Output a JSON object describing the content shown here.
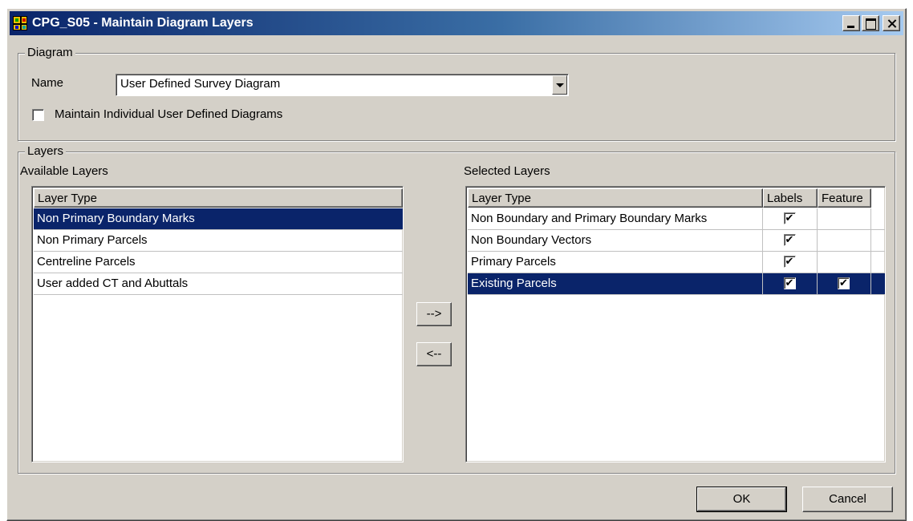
{
  "window": {
    "title": "CPG_S05 - Maintain Diagram Layers"
  },
  "diagram": {
    "legend": "Diagram",
    "name_label": "Name",
    "name_value": "User Defined Survey Diagram",
    "individual_label": "Maintain Individual User Defined Diagrams",
    "individual_checked": false
  },
  "layers": {
    "legend": "Layers",
    "available": {
      "title": "Available Layers",
      "header": "Layer Type",
      "items": [
        "Non Primary Boundary Marks",
        "Non Primary Parcels",
        "Centreline Parcels",
        "User added CT and Abuttals"
      ],
      "selected_index": 0
    },
    "add_button": "-->",
    "remove_button": "<--",
    "selected": {
      "title": "Selected Layers",
      "headers": [
        "Layer Type",
        "Labels",
        "Feature"
      ],
      "rows": [
        {
          "type": "Non Boundary and Primary Boundary Marks",
          "labels": true,
          "feature": null
        },
        {
          "type": "Non Boundary Vectors",
          "labels": true,
          "feature": null
        },
        {
          "type": "Primary Parcels",
          "labels": true,
          "feature": null
        },
        {
          "type": "Existing Parcels",
          "labels": true,
          "feature": true
        }
      ],
      "selected_index": 3
    }
  },
  "footer": {
    "ok_label": "OK",
    "cancel_label": "Cancel"
  },
  "colors": {
    "selection": "#0a246a",
    "face": "#d4d0c8"
  },
  "icons": {
    "app": "app-icon",
    "check": "check-icon"
  }
}
